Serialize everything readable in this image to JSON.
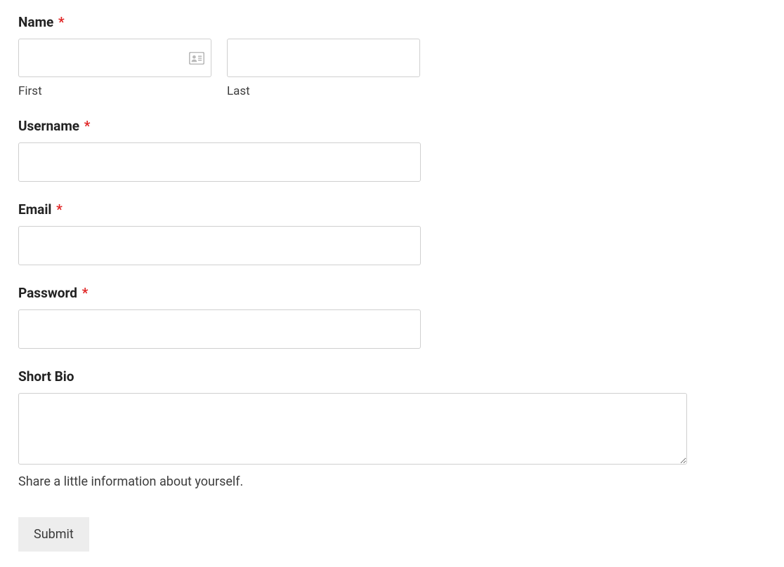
{
  "fields": {
    "name": {
      "label": "Name",
      "required_marker": "*",
      "first_sublabel": "First",
      "last_sublabel": "Last",
      "first_value": "",
      "last_value": ""
    },
    "username": {
      "label": "Username",
      "required_marker": "*",
      "value": ""
    },
    "email": {
      "label": "Email",
      "required_marker": "*",
      "value": ""
    },
    "password": {
      "label": "Password",
      "required_marker": "*",
      "value": ""
    },
    "short_bio": {
      "label": "Short Bio",
      "value": "",
      "helper": "Share a little information about yourself."
    }
  },
  "submit_label": "Submit"
}
